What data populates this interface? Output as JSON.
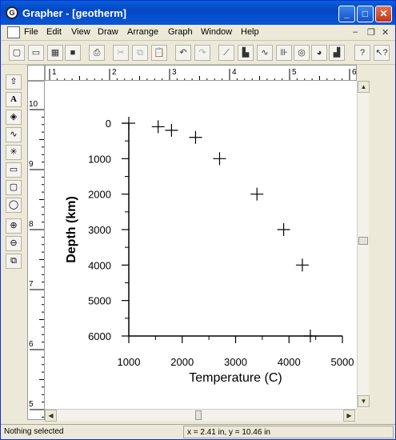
{
  "window": {
    "title": "Grapher - [geotherm]"
  },
  "menu": [
    "File",
    "Edit",
    "View",
    "Draw",
    "Arrange",
    "Graph",
    "Window",
    "Help"
  ],
  "ruler": {
    "h_labels": [
      "1",
      "2",
      "3",
      "4",
      "5",
      "6"
    ],
    "v_labels": [
      "10",
      "9",
      "8",
      "7",
      "6",
      "5"
    ]
  },
  "chart_data": {
    "type": "scatter",
    "marker": "plus",
    "x": [
      1000,
      1550,
      1800,
      2250,
      2700,
      3400,
      3900,
      4250,
      4400
    ],
    "y": [
      0,
      100,
      200,
      400,
      1000,
      2000,
      3000,
      4000,
      6000
    ],
    "xlabel": "Temperature (C)",
    "ylabel": "Depth (km)",
    "xlim": [
      1000,
      5000
    ],
    "ylim": [
      6000,
      0
    ],
    "x_ticks": [
      "1000",
      "2000",
      "3000",
      "4000",
      "5000"
    ],
    "y_ticks": [
      "0",
      "1000",
      "2000",
      "3000",
      "4000",
      "5000",
      "6000"
    ],
    "y_inverted": true,
    "grid": false,
    "legend": "none"
  },
  "status": {
    "left": "Nothing selected",
    "right": "x = 2.41 in, y = 10.46 in"
  }
}
